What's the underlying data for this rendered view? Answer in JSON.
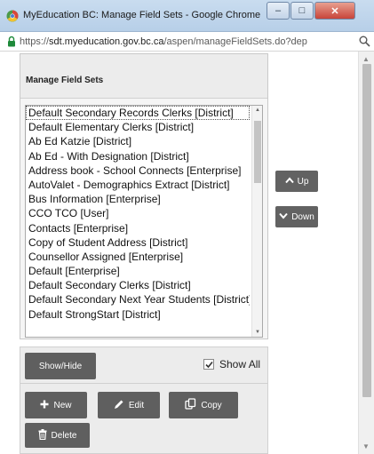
{
  "window": {
    "title": "MyEducation BC: Manage Field Sets - Google Chrome",
    "minimize_glyph": "–",
    "maximize_glyph": "□",
    "close_glyph": "✕"
  },
  "address_bar": {
    "scheme": "https://",
    "host": "sdt.myeducation.gov.bc.ca",
    "path": "/aspen/manageFieldSets.do?dep"
  },
  "panel": {
    "title": "Manage Field Sets"
  },
  "field_sets": [
    "Default Secondary Records Clerks [District]",
    "Default Elementary Clerks [District]",
    "Ab Ed Katzie [District]",
    "Ab Ed - With Designation [District]",
    "Address book - School Connects [Enterprise]",
    "AutoValet - Demographics Extract [District]",
    "Bus Information [Enterprise]",
    "CCO TCO [User]",
    "Contacts [Enterprise]",
    "Copy of Student Address [District]",
    "Counsellor Assigned [Enterprise]",
    "Default [Enterprise]",
    "Default Secondary Clerks [District]",
    "Default Secondary Next Year Students [District]",
    "Default StrongStart [District]"
  ],
  "move_buttons": {
    "up_label": "Up",
    "down_label": "Down"
  },
  "toolbar": {
    "show_hide_label": "Show/Hide",
    "show_all_label": "Show All",
    "show_all_checked": true,
    "new_label": "New",
    "edit_label": "Edit",
    "copy_label": "Copy",
    "delete_label": "Delete"
  },
  "colors": {
    "button_dark": "#5f5f5f",
    "titlebar": "#c9dcef"
  },
  "icons": {
    "chrome_icon": "chrome-icon",
    "lock": "lock-icon",
    "zoom": "magnifier-icon"
  }
}
